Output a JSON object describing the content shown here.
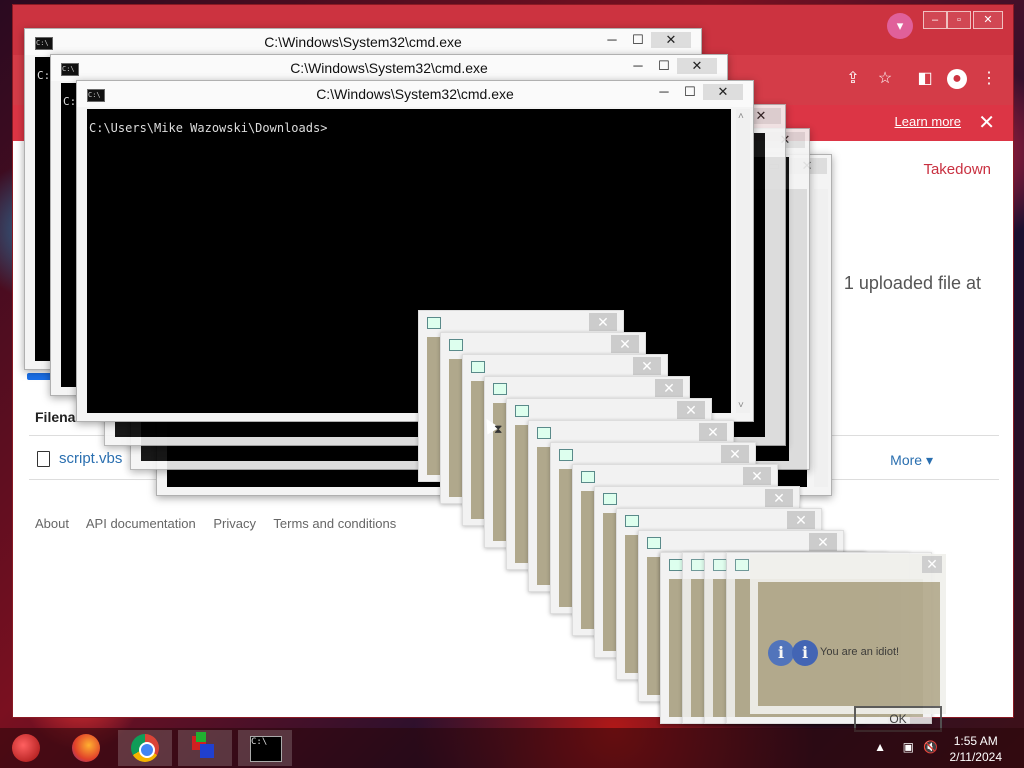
{
  "cmd": {
    "title": "C:\\Windows\\System32\\cmd.exe",
    "prompt": "C:\\Users\\Mike Wazowski\\Downloads>",
    "icon": "C:\\",
    "partial_prompt": "C:"
  },
  "browser": {
    "infobar": {
      "learn_more": "Learn more"
    },
    "takedown": "Takedown",
    "uploaded_text": "1 uploaded file at",
    "filename_header": "Filena",
    "file_link": "script.vbs",
    "more": "More ▾",
    "footer": [
      "About",
      "API documentation",
      "Privacy",
      "Terms and conditions"
    ]
  },
  "dialog": {
    "message": "You are an idiot!",
    "ok": "OK",
    "ok_ghost": "OK"
  },
  "taskbar": {
    "time": "1:55 AM",
    "date": "2/11/2024",
    "apps": [
      "start-button",
      "firefox-icon",
      "chrome-icon",
      "app-icon",
      "cmd-icon"
    ]
  }
}
